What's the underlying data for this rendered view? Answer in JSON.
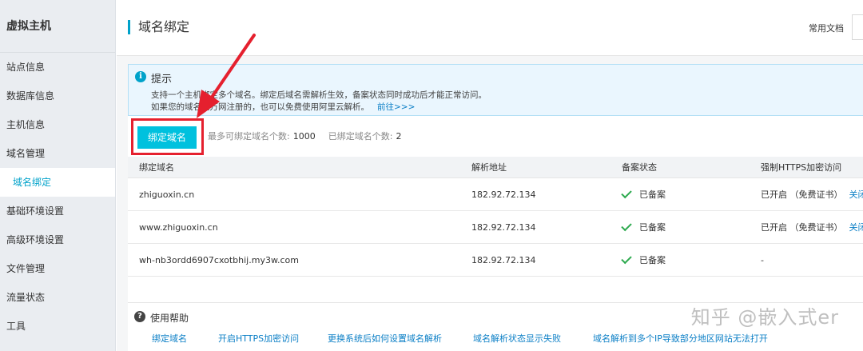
{
  "sidebar": {
    "title": "虚拟主机",
    "items": [
      {
        "label": "站点信息"
      },
      {
        "label": "数据库信息"
      },
      {
        "label": "主机信息"
      },
      {
        "label": "域名管理"
      },
      {
        "label": "域名绑定"
      },
      {
        "label": "基础环境设置"
      },
      {
        "label": "高级环境设置"
      },
      {
        "label": "文件管理"
      },
      {
        "label": "流量状态"
      },
      {
        "label": "工具"
      }
    ]
  },
  "header": {
    "title": "域名绑定",
    "doc_link": "常用文档"
  },
  "tip": {
    "title": "提示",
    "line1": "支持一个主机绑定多个域名。绑定后域名需解析生效，备案状态同时成功后才能正常访问。",
    "line2": "如果您的域名是万网注册的，也可以免费使用阿里云解析。",
    "link": "前往>>>"
  },
  "actions": {
    "bind_button": "绑定域名",
    "max_label": "最多可绑定域名个数:",
    "max_value": "1000",
    "bound_label": "已绑定域名个数:",
    "bound_value": "2"
  },
  "table": {
    "headers": [
      "绑定域名",
      "解析地址",
      "备案状态",
      "强制HTTPS加密访问"
    ],
    "rows": [
      {
        "domain": "zhiguoxin.cn",
        "ip": "182.92.72.134",
        "status": "已备案",
        "https": "已开启 （免费证书）",
        "action": "关闭"
      },
      {
        "domain": "www.zhiguoxin.cn",
        "ip": "182.92.72.134",
        "status": "已备案",
        "https": "已开启 （免费证书）",
        "action": "关闭"
      },
      {
        "domain": "wh-nb3ordd6907cxotbhij.my3w.com",
        "ip": "182.92.72.134",
        "status": "已备案",
        "https": "-",
        "action": ""
      }
    ]
  },
  "help": {
    "title": "使用帮助",
    "links": [
      "绑定域名",
      "开启HTTPS加密访问",
      "更换系统后如何设置域名解析",
      "域名解析状态显示失败",
      "域名解析到多个IP导致部分地区网站无法打开"
    ]
  },
  "watermark": "知乎 @嵌入式er",
  "colors": {
    "accent": "#00a2ca",
    "button": "#00c1de",
    "highlight": "#e5202e",
    "success": "#2eaa4f",
    "link": "#0b7fc6"
  }
}
